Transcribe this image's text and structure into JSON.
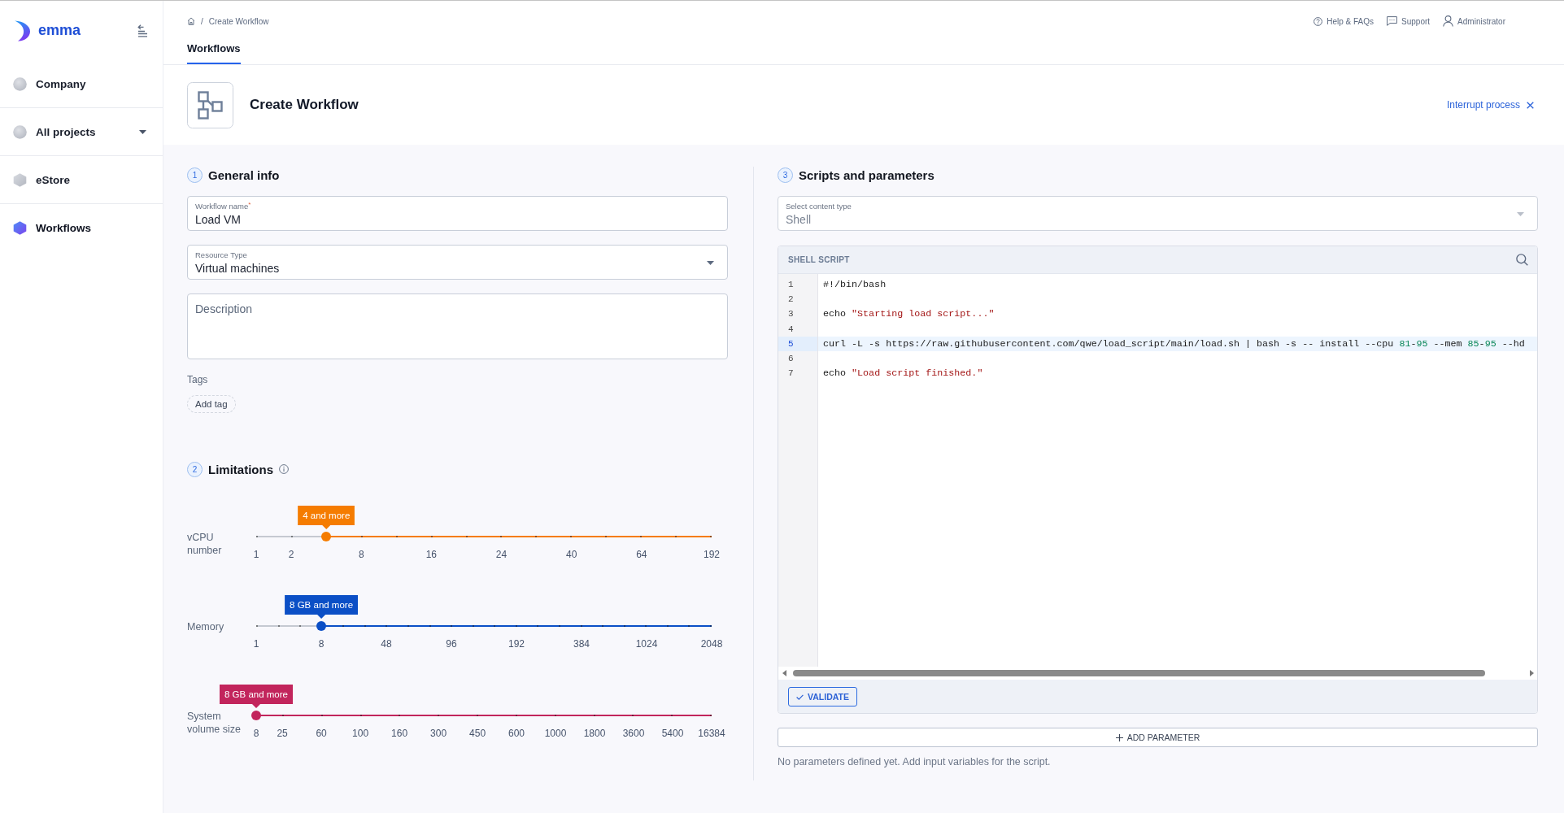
{
  "sidebar": {
    "logo": "emma",
    "items": [
      {
        "label": "Company",
        "kind": "company",
        "selected": false
      },
      {
        "label": "All projects",
        "kind": "group",
        "selected": false
      },
      {
        "label": "eStore",
        "kind": "project",
        "selected": false
      },
      {
        "label": "Workflows",
        "kind": "project",
        "selected": true
      }
    ]
  },
  "top_bar": {
    "breadcrumb": {
      "separator": "/",
      "current": "Create Workflow"
    },
    "links": [
      {
        "label": "Help & FAQs",
        "kind": "help"
      },
      {
        "label": "Support",
        "kind": "support"
      },
      {
        "label": "Administrator",
        "kind": "user"
      }
    ]
  },
  "tabs": [
    {
      "label": "Workflows",
      "selected": true
    }
  ],
  "header": {
    "title": "Create Workflow",
    "action": "Interrupt process"
  },
  "general_info": {
    "step": "1",
    "title": "General info",
    "fields": [
      {
        "kind": "text",
        "label": "Workflow name$^{*}$",
        "value": "Load VM"
      },
      {
        "kind": "select",
        "label": "Resource Type",
        "value": "Virtual machines"
      },
      {
        "kind": "textarea",
        "placeholder": "Description"
      }
    ],
    "tags_label": "Tags",
    "add_tag": "Add tag"
  },
  "limitations": {
    "step": "2",
    "title": "Limitations",
    "sliders": [
      {
        "label": "vCPU number",
        "reading": "4 and more",
        "level": 0.154,
        "color": "#f57c00",
        "ticks": [
          "1",
          "2",
          "8",
          "16",
          "24",
          "40",
          "64",
          "192"
        ]
      },
      {
        "label": "Memory",
        "reading": "8 GB and more",
        "level": 0.143,
        "color": "#0b4fc6",
        "ticks": [
          "1",
          "8",
          "48",
          "96",
          "192",
          "384",
          "1024",
          "2048"
        ]
      },
      {
        "label": "System volume size",
        "reading": "8 GB and more",
        "level": 0,
        "color": "#c2255c",
        "ticks": [
          "8",
          "25",
          "60",
          "100",
          "160",
          "300",
          "450",
          "600",
          "1000",
          "1800",
          "3600",
          "5400",
          "16384"
        ]
      }
    ]
  },
  "scripts": {
    "step": "3",
    "title": "Scripts and parameters",
    "content_type": {
      "label": "Select content type",
      "value": "Shell",
      "disabled": true
    },
    "editor": {
      "title": "SHELL SCRIPT",
      "lines": [
        {
          "number": "1",
          "active": false,
          "tokens": [
            {
              "kind": "plain",
              "text": "#!/bin/bash"
            }
          ]
        },
        {
          "number": "2",
          "active": false
        },
        {
          "number": "3",
          "active": false,
          "tokens": [
            {
              "kind": "plain",
              "text": "echo "
            },
            {
              "kind": "string",
              "text": "\"Starting load script...\""
            }
          ]
        },
        {
          "number": "4",
          "active": false
        },
        {
          "number": "5",
          "active": true,
          "tokens": [
            {
              "kind": "plain",
              "text": "curl -L -s https://raw.githubusercontent.com/qwe/load_script/main/load.sh | bash -s -- install --cpu "
            },
            {
              "kind": "number",
              "text": "81"
            },
            {
              "kind": "plain",
              "text": "-"
            },
            {
              "kind": "number",
              "text": "95"
            },
            {
              "kind": "plain",
              "text": " --mem "
            },
            {
              "kind": "number",
              "text": "85"
            },
            {
              "kind": "plain",
              "text": "-"
            },
            {
              "kind": "number",
              "text": "95"
            },
            {
              "kind": "plain",
              "text": " --hd"
            }
          ]
        },
        {
          "number": "6",
          "active": false
        },
        {
          "number": "7",
          "active": false,
          "tokens": [
            {
              "kind": "plain",
              "text": "echo "
            },
            {
              "kind": "string",
              "text": "\"Load script finished.\""
            }
          ]
        }
      ]
    },
    "validate": "VALIDATE",
    "add_parameter": "ADD PARAMETER",
    "hint": "No parameters defined yet. Add input variables for the script."
  }
}
